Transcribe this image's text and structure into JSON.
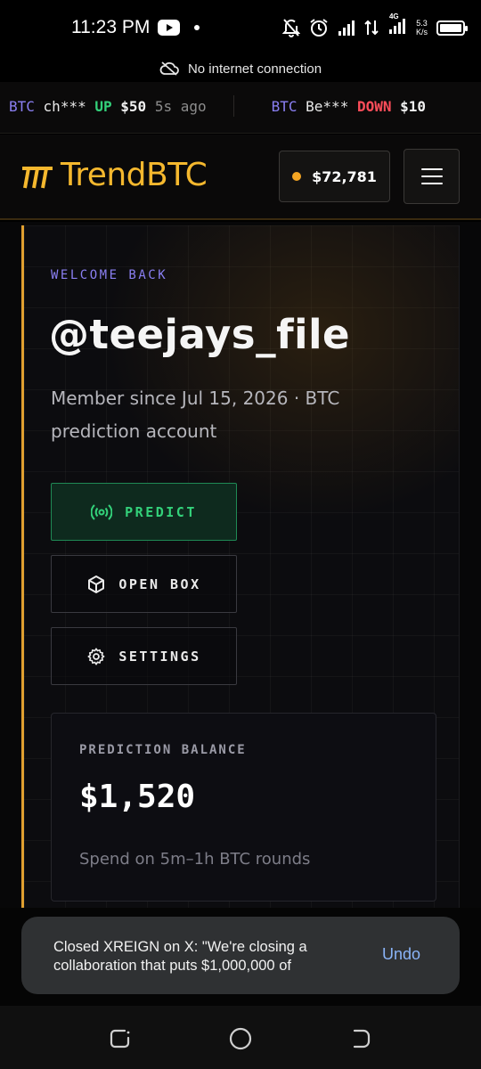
{
  "status_bar": {
    "time": "11:23 PM",
    "net_speed_value": "5.3",
    "net_speed_unit": "K/s",
    "network_type": "4G"
  },
  "connection_banner": {
    "text": "No internet connection",
    "icon": "cloud-off-icon"
  },
  "ticker": {
    "items": [
      {
        "coin": "BTC",
        "user": "ch***",
        "direction": "UP",
        "amount": "$50",
        "ago": "5s ago"
      },
      {
        "coin": "BTC",
        "user": "Be***",
        "direction": "DOWN",
        "amount": "$10",
        "ago": ""
      }
    ],
    "colors": {
      "up": "#33d17a",
      "down": "#ff4d5a",
      "coin": "#8a7ff2"
    }
  },
  "header": {
    "logo_text": "TrendBTC",
    "btc_price": "$72,781",
    "menu_icon": "hamburger-menu-icon",
    "brand_color": "#f5b82e"
  },
  "profile": {
    "welcome_label": "WELCOME BACK",
    "username": "@teejays_file",
    "member_line": "Member since Jul 15, 2026 · BTC prediction account"
  },
  "actions": {
    "predict": {
      "label": "PREDICT",
      "icon": "broadcast-icon"
    },
    "open_box": {
      "label": "OPEN BOX",
      "icon": "box-icon"
    },
    "settings": {
      "label": "SETTINGS",
      "icon": "gear-icon"
    }
  },
  "balance": {
    "label": "PREDICTION BALANCE",
    "value": "$1,520",
    "subtitle": "Spend on 5m–1h BTC rounds"
  },
  "snackbar": {
    "text": "Closed XREIGN on X: \"We're closing a collaboration that puts $1,000,000 of",
    "action": "Undo"
  }
}
